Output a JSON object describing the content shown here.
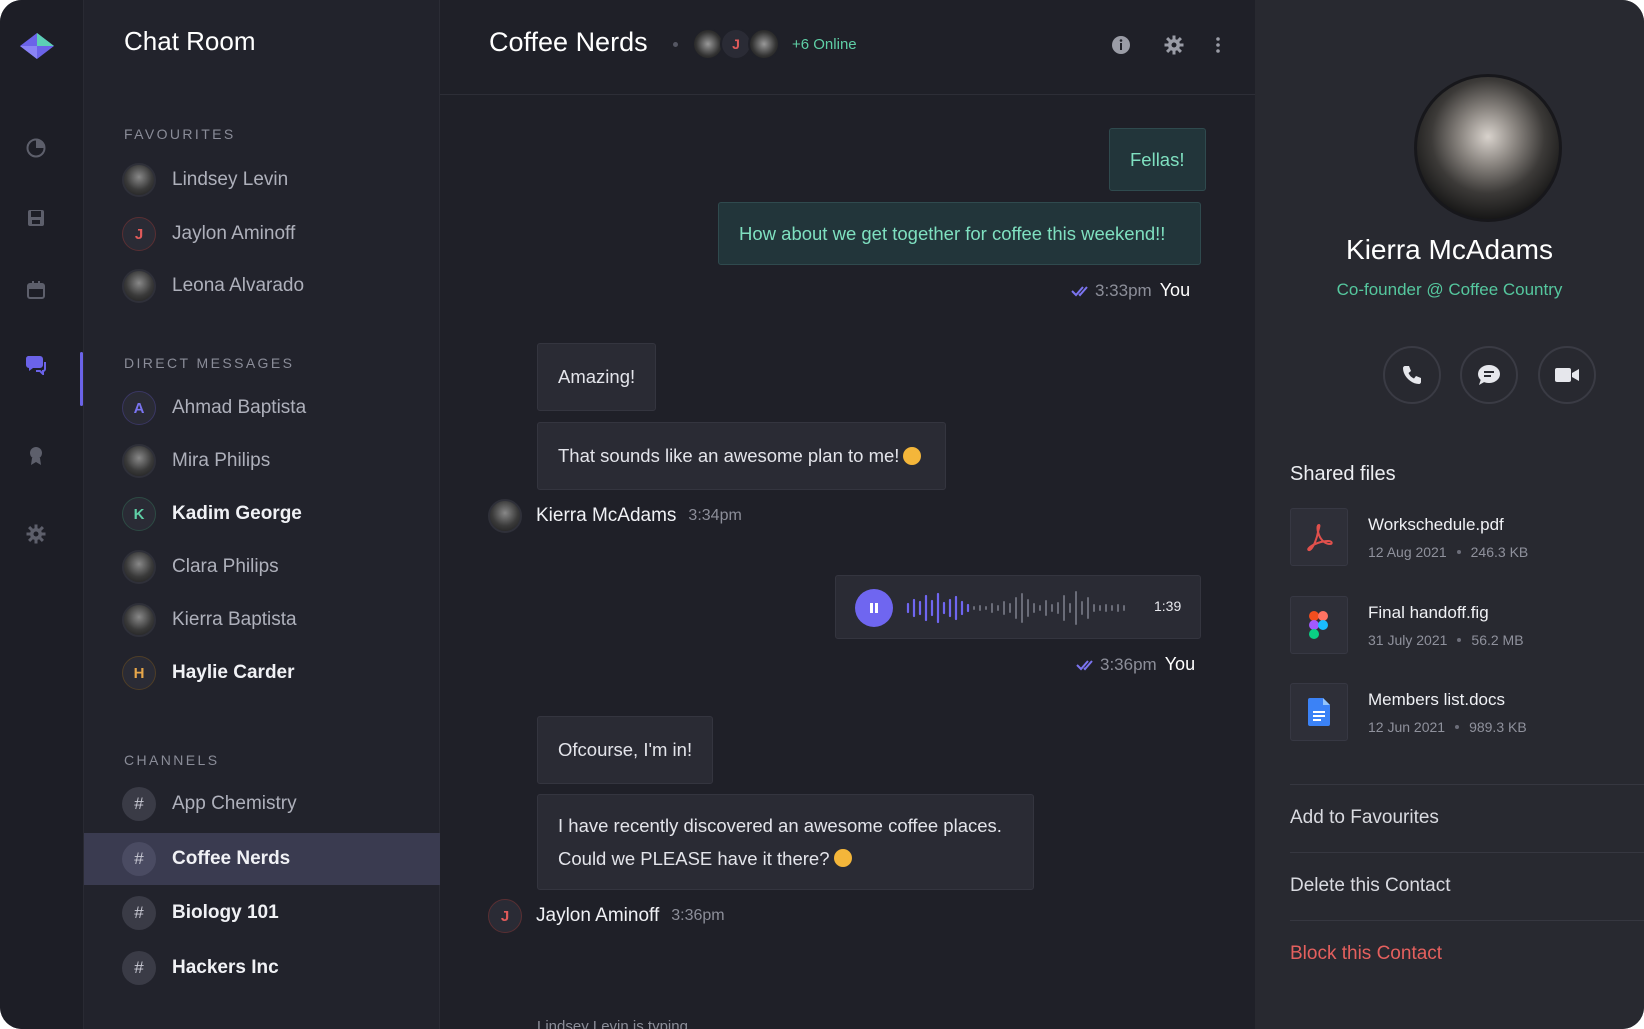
{
  "app": {
    "title": "Chat Room"
  },
  "sidebar": {
    "favourites_label": "FAVOURITES",
    "favourites": [
      {
        "name": "Lindsey Levin"
      },
      {
        "name": "Jaylon Aminoff",
        "initial": "J"
      },
      {
        "name": "Leona Alvarado"
      }
    ],
    "dm_label": "DIRECT MESSAGES",
    "direct_messages": [
      {
        "name": "Ahmad Baptista",
        "initial": "A"
      },
      {
        "name": "Mira Philips"
      },
      {
        "name": "Kadim George",
        "initial": "K"
      },
      {
        "name": "Clara Philips"
      },
      {
        "name": "Kierra Baptista"
      },
      {
        "name": "Haylie Carder",
        "initial": "H"
      }
    ],
    "channels_label": "CHANNELS",
    "channels": [
      {
        "name": "App Chemistry",
        "symbol": "#"
      },
      {
        "name": "Coffee Nerds",
        "symbol": "#"
      },
      {
        "name": "Biology 101",
        "symbol": "#"
      },
      {
        "name": "Hackers Inc",
        "symbol": "#"
      }
    ]
  },
  "chat": {
    "title": "Coffee Nerds",
    "header_initial": "J",
    "online": "+6 Online",
    "messages": {
      "m1": "Fellas!",
      "m2": "How about we get together for coffee this weekend!!",
      "m2_time": "3:33pm",
      "m2_who": "You",
      "m3": "Amazing!",
      "m4": "That sounds like an awesome plan to me!",
      "m4_sender": "Kierra McAdams",
      "m4_time": "3:34pm",
      "voice_duration": "1:39",
      "voice_time": "3:36pm",
      "voice_who": "You",
      "m5": "Ofcourse, I'm in!",
      "m6_line1": "I have recently discovered an awesome coffee places.",
      "m6_line2": "Could we PLEASE have it there?",
      "m6_sender": "Jaylon Aminoff",
      "m6_sender_initial": "J",
      "m6_time": "3:36pm"
    },
    "typing": "Lindsey Levin is typing..."
  },
  "profile": {
    "name": "Kierra McAdams",
    "role": "Co-founder @ Coffee Country",
    "files_title": "Shared files",
    "files": [
      {
        "name": "Workschedule.pdf",
        "date": "12 Aug 2021",
        "size": "246.3 KB",
        "icon": "pdf-icon"
      },
      {
        "name": "Final handoff.fig",
        "date": "31 July 2021",
        "size": "56.2 MB",
        "icon": "figma-icon"
      },
      {
        "name": "Members list.docs",
        "date": "12 Jun 2021",
        "size": "989.3 KB",
        "icon": "doc-icon"
      }
    ],
    "actions": {
      "add_fav": "Add to Favourites",
      "delete": "Delete this Contact",
      "block": "Block this Contact"
    }
  },
  "colors": {
    "accent": "#6f66f0",
    "online": "#5fcfa6",
    "danger": "#e5605e",
    "background": "#1f2028"
  }
}
